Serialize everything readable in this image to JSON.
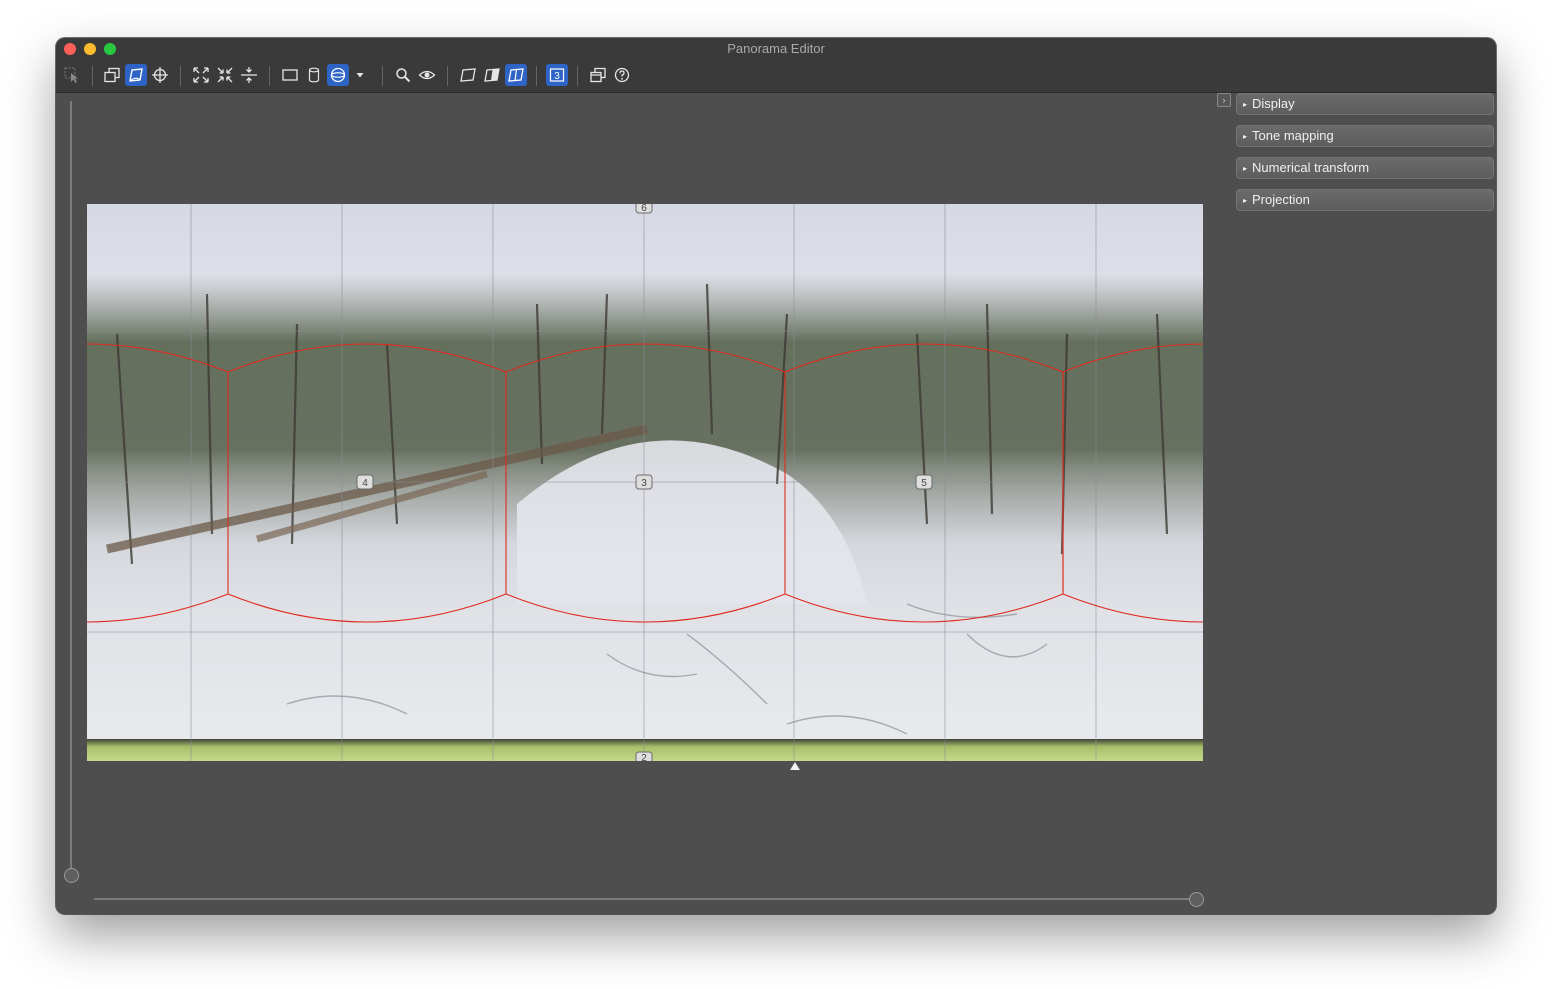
{
  "window": {
    "title": "Panorama Editor"
  },
  "toolbar": {
    "items": [
      {
        "id": "select",
        "icon": "select-arrow-icon",
        "active": false
      },
      {
        "id": "layout",
        "icon": "overlapping-frames-icon",
        "active": false
      },
      {
        "id": "move-drag",
        "icon": "move-drag-icon",
        "active": true
      },
      {
        "id": "identify",
        "icon": "crosshair-icon",
        "active": false
      },
      {
        "id": "fit",
        "icon": "expand-arrows-icon",
        "active": false
      },
      {
        "id": "crop",
        "icon": "compress-arrows-icon",
        "active": false
      },
      {
        "id": "straighten",
        "icon": "straighten-icon",
        "active": false
      },
      {
        "id": "rectilinear",
        "icon": "rectangle-projection-icon",
        "active": false
      },
      {
        "id": "cylindrical",
        "icon": "cylinder-projection-icon",
        "active": false
      },
      {
        "id": "equirectangular",
        "icon": "sphere-projection-icon",
        "active": true
      },
      {
        "id": "projection-menu",
        "icon": "dropdown-arrow-icon",
        "active": false
      },
      {
        "id": "zoom",
        "icon": "magnifier-icon",
        "active": false
      },
      {
        "id": "preview",
        "icon": "eye-icon",
        "active": false
      },
      {
        "id": "view-normal",
        "icon": "skewed-frame-icon",
        "active": false
      },
      {
        "id": "view-masks",
        "icon": "half-filled-frame-icon",
        "active": false
      },
      {
        "id": "view-outlines",
        "icon": "split-frame-icon",
        "active": true
      },
      {
        "id": "image-count",
        "icon": "numbered-frame-icon",
        "label": "3",
        "active": true
      },
      {
        "id": "show-images",
        "icon": "stacked-windows-icon",
        "active": false
      },
      {
        "id": "help",
        "icon": "help-circle-icon",
        "active": false
      }
    ]
  },
  "panorama": {
    "image_labels": [
      {
        "label": "6"
      },
      {
        "label": "4"
      },
      {
        "label": "3"
      },
      {
        "label": "5"
      },
      {
        "label": "2"
      }
    ],
    "outline_color": "#e02a1e"
  },
  "sidebar": {
    "panels": [
      {
        "label": "Display"
      },
      {
        "label": "Tone mapping"
      },
      {
        "label": "Numerical transform"
      },
      {
        "label": "Projection"
      }
    ]
  },
  "colors": {
    "window_bg": "#4e4e4e",
    "titlebar_bg": "#3a3a3a",
    "accent": "#2d64c6"
  }
}
